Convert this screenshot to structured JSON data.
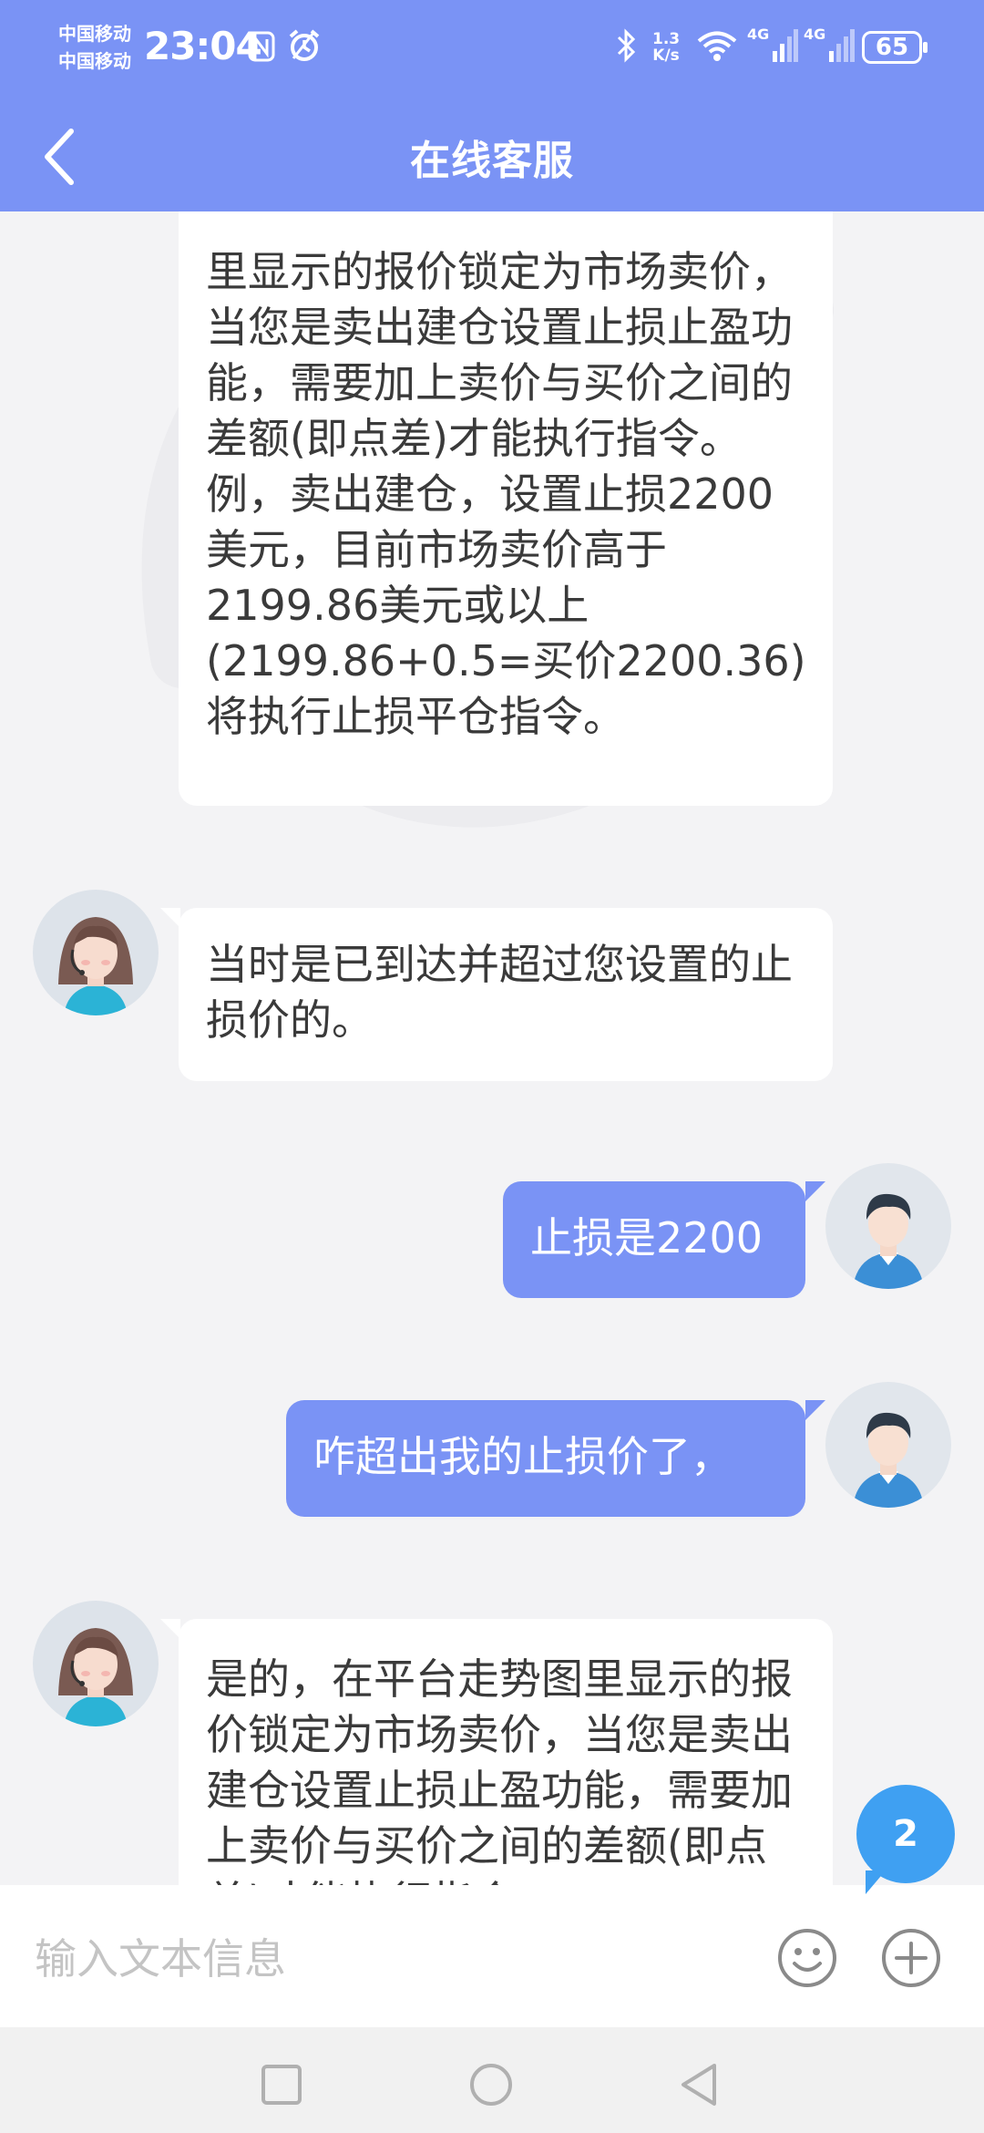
{
  "status_bar": {
    "carrier_1": "中国移动",
    "carrier_2": "中国移动",
    "time": "23:04",
    "net_speed_value": "1.3",
    "net_speed_unit": "K/s",
    "sim1_label": "4G",
    "sim2_label": "4G",
    "battery": "65"
  },
  "header": {
    "title": "在线客服"
  },
  "messages": [
    {
      "sender": "agent",
      "text": "里显示的报价锁定为市场卖价，当您是卖出建仓设置止损止盈功能，需要加上卖价与买价之间的差额(即点差)才能执行指令。例，卖出建仓，设置止损2200美元，目前市场卖价高于2199.86美元或以上(2199.86+0.5=买价2200.36)将执行止损平仓指令。"
    },
    {
      "sender": "agent",
      "text": "当时是已到达并超过您设置的止损价的。"
    },
    {
      "sender": "user",
      "text": "止损是2200"
    },
    {
      "sender": "user",
      "text": "咋超出我的止损价了，"
    },
    {
      "sender": "agent",
      "text": "是的，在平台走势图里显示的报价锁定为市场卖价，当您是卖出建仓设置止损止盈功能，需要加上卖价与买价之间的差额(即点差)才能执行指令"
    }
  ],
  "unread_badge": "2",
  "input": {
    "placeholder": "输入文本信息",
    "value": ""
  },
  "icons": {
    "back": "chevron-left-icon",
    "emoji": "smiley-icon",
    "more": "plus-circle-icon",
    "agent_avatar": "headset-agent-avatar",
    "user_avatar": "user-avatar"
  },
  "colors": {
    "header": "#7a93f5",
    "user_bubble": "#7a93f5",
    "agent_bubble": "#ffffff",
    "badge": "#3fa0f2",
    "background": "#f3f3f5"
  }
}
